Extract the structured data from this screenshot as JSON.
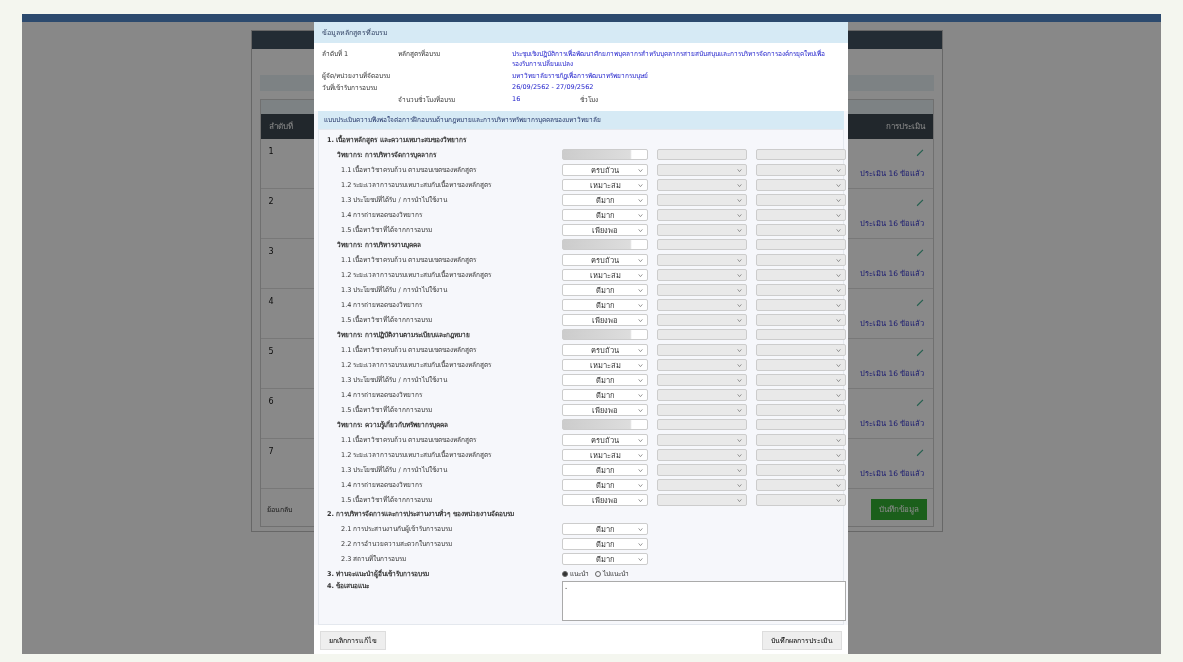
{
  "background": {
    "columns": [
      "ลำดับที่",
      "การประเมิน"
    ],
    "rows": [
      {
        "number": "1",
        "status": "ประเมิน 16 ข้อแล้ว"
      },
      {
        "number": "2",
        "status": "ประเมิน 16 ข้อแล้ว"
      },
      {
        "number": "3",
        "status": "ประเมิน 16 ข้อแล้ว"
      },
      {
        "number": "4",
        "status": "ประเมิน 16 ข้อแล้ว"
      },
      {
        "number": "5",
        "status": "ประเมิน 16 ข้อแล้ว"
      },
      {
        "number": "6",
        "status": "ประเมิน 16 ข้อแล้ว"
      },
      {
        "number": "7",
        "status": "ประเมิน 16 ข้อแล้ว"
      }
    ],
    "back_link": "ย้อนกลับ",
    "save_button": "บันทึกข้อมูล"
  },
  "modal": {
    "title": "ข้อมูลหลักสูตรที่อบรม",
    "info": {
      "order_label": "ลำดับที่ 1",
      "course_label": "หลักสูตรที่อบรม",
      "course": "ประชุมเชิงปฏิบัติการเพื่อพัฒนาศักยภาพบุคลากรสำหรับบุคลากรสายสนับสนุนและการบริหารจัดการองค์กรยุคใหม่เพื่อรองรับการเปลี่ยนแปลง",
      "org_label": "ผู้จัด/หน่วยงานที่จัดอบรม",
      "org": "มหาวิทยาลัยราชภัฏเพื่อการพัฒนาทรัพยากรมนุษย์",
      "date_label": "วันที่เข้ารับการอบรม",
      "date": "26/09/2562 - 27/09/2562",
      "hours_label": "จำนวนชั่วโมงที่อบรม",
      "hours": "16",
      "hours_unit": "ชั่วโมง"
    },
    "form_title": "แบบประเมินความพึงพอใจต่อการฝึกอบรมด้านกฎหมายและการบริหารทรัพยากรบุคคลของมหาวิทยาลัย",
    "sections": [
      {
        "kind": "trainers",
        "title": "1. เนื้อหาหลักสูตร และความเหมาะสมของวิทยากร",
        "trainers": [
          {
            "label": "วิทยากร: การบริหารจัดการบุคลากร",
            "items": [
              {
                "label": "1.1 เนื้อหาวิชาครบถ้วน ตามขอบเขตของหลักสูตร",
                "value": "ครบถ้วน"
              },
              {
                "label": "1.2 ระยะเวลาการอบรมเหมาะสมกับเนื้อหาของหลักสูตร",
                "value": "เหมาะสม"
              },
              {
                "label": "1.3 ประโยชน์ที่ได้รับ / การนำไปใช้งาน",
                "value": "ดีมาก"
              },
              {
                "label": "1.4 การถ่ายทอดของวิทยากร",
                "value": "ดีมาก"
              },
              {
                "label": "1.5 เนื้อหาวิชาที่ได้จากการอบรม",
                "value": "เพียงพอ"
              }
            ]
          },
          {
            "label": "วิทยากร: การบริหารงานบุคคล",
            "items": [
              {
                "label": "1.1 เนื้อหาวิชาครบถ้วน ตามขอบเขตของหลักสูตร",
                "value": "ครบถ้วน"
              },
              {
                "label": "1.2 ระยะเวลาการอบรมเหมาะสมกับเนื้อหาของหลักสูตร",
                "value": "เหมาะสม"
              },
              {
                "label": "1.3 ประโยชน์ที่ได้รับ / การนำไปใช้งาน",
                "value": "ดีมาก"
              },
              {
                "label": "1.4 การถ่ายทอดของวิทยากร",
                "value": "ดีมาก"
              },
              {
                "label": "1.5 เนื้อหาวิชาที่ได้จากการอบรม",
                "value": "เพียงพอ"
              }
            ]
          },
          {
            "label": "วิทยากร: การปฏิบัติงานตามระเบียบและกฎหมาย",
            "items": [
              {
                "label": "1.1 เนื้อหาวิชาครบถ้วน ตามขอบเขตของหลักสูตร",
                "value": "ครบถ้วน"
              },
              {
                "label": "1.2 ระยะเวลาการอบรมเหมาะสมกับเนื้อหาของหลักสูตร",
                "value": "เหมาะสม"
              },
              {
                "label": "1.3 ประโยชน์ที่ได้รับ / การนำไปใช้งาน",
                "value": "ดีมาก"
              },
              {
                "label": "1.4 การถ่ายทอดของวิทยากร",
                "value": "ดีมาก"
              },
              {
                "label": "1.5 เนื้อหาวิชาที่ได้จากการอบรม",
                "value": "เพียงพอ"
              }
            ]
          },
          {
            "label": "วิทยากร: ความรู้เกี่ยวกับทรัพยากรบุคคล",
            "items": [
              {
                "label": "1.1 เนื้อหาวิชาครบถ้วน ตามขอบเขตของหลักสูตร",
                "value": "ครบถ้วน"
              },
              {
                "label": "1.2 ระยะเวลาการอบรมเหมาะสมกับเนื้อหาของหลักสูตร",
                "value": "เหมาะสม"
              },
              {
                "label": "1.3 ประโยชน์ที่ได้รับ / การนำไปใช้งาน",
                "value": "ดีมาก"
              },
              {
                "label": "1.4 การถ่ายทอดของวิทยากร",
                "value": "ดีมาก"
              },
              {
                "label": "1.5 เนื้อหาวิชาที่ได้จากการอบรม",
                "value": "เพียงพอ"
              }
            ]
          }
        ]
      },
      {
        "kind": "selects",
        "title": "2. การบริหารจัดการและการประสานงานทั่วๆ ของหน่วยงานจัดอบรม",
        "items": [
          {
            "label": "2.1 การประสานงานกับผู้เข้ารับการอบรม",
            "value": "ดีมาก"
          },
          {
            "label": "2.2 การอำนวยความสะดวกในการอบรม",
            "value": "ดีมาก"
          },
          {
            "label": "2.3 สถานที่ในการอบรม",
            "value": "ดีมาก"
          }
        ]
      },
      {
        "kind": "radio",
        "title": "3. ท่านจะแนะนำผู้อื่นเข้ารับการอบรม",
        "options": [
          {
            "label": "แนะนำ",
            "selected": true
          },
          {
            "label": "ไม่แนะนำ",
            "selected": false
          }
        ]
      },
      {
        "kind": "textarea",
        "title": "4. ข้อเสนอแนะ",
        "value": "-"
      }
    ],
    "cancel_button": "ยกเลิกการแก้ไข",
    "save_button": "บันทึกผลการประเมิน"
  }
}
